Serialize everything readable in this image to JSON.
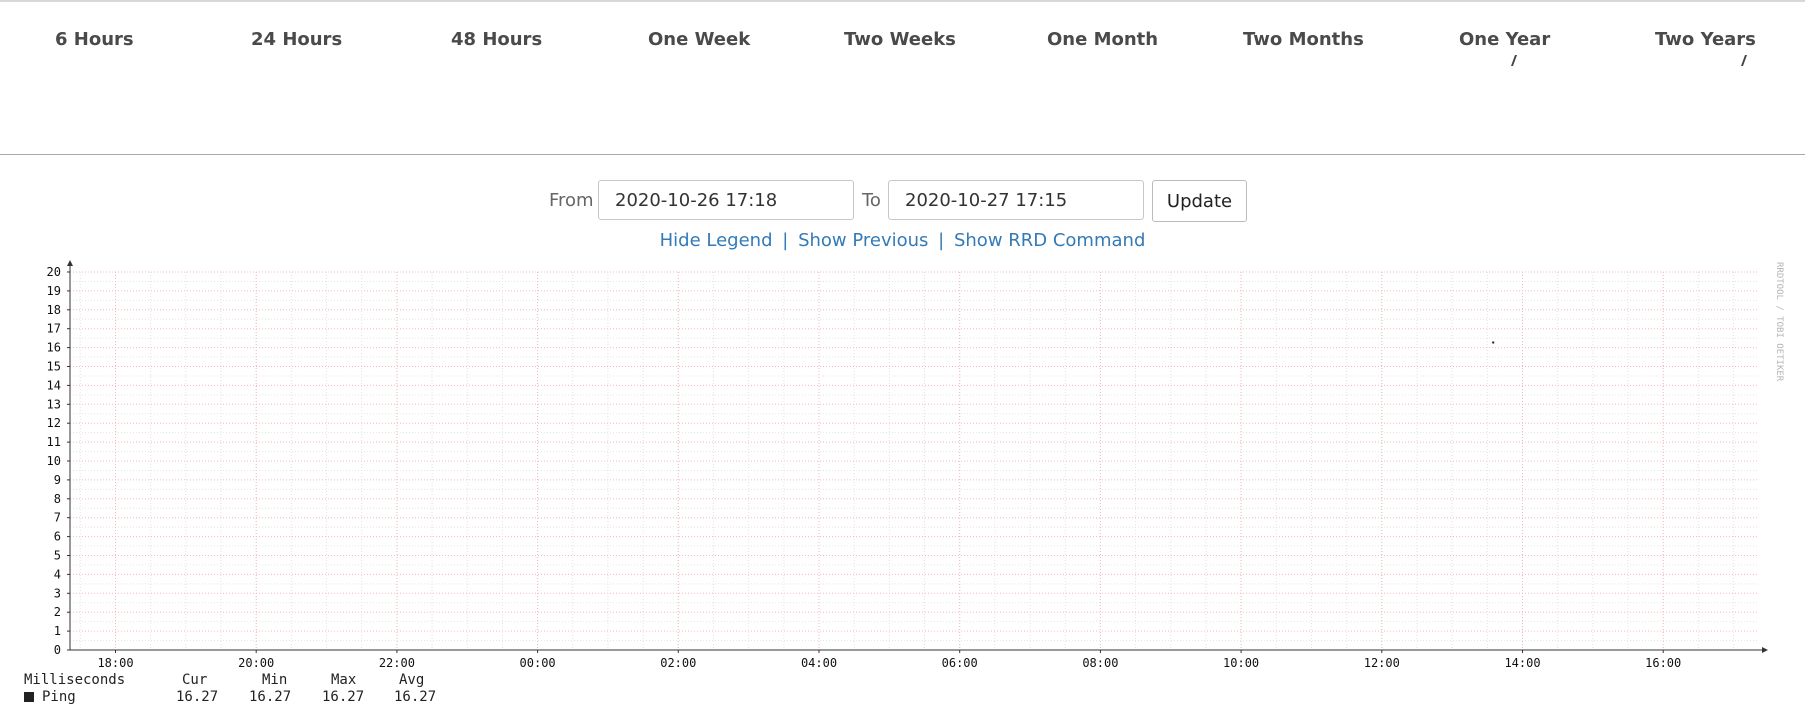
{
  "tabs": [
    "6 Hours",
    "24 Hours",
    "48 Hours",
    "One Week",
    "Two Weeks",
    "One Month",
    "Two Months",
    "One Year",
    "Two Years"
  ],
  "range": {
    "from_label": "From",
    "from_value": "2020-10-26 17:18",
    "to_label": "To",
    "to_value": "2020-10-27 17:15",
    "update_label": "Update"
  },
  "links": {
    "hide_legend": "Hide Legend",
    "separator": "|",
    "show_previous": "Show Previous",
    "show_rrd": "Show RRD Command"
  },
  "chart_data": {
    "type": "line",
    "yticks": [
      "20",
      "19",
      "18",
      "17",
      "16",
      "15",
      "14",
      "13",
      "12",
      "11",
      "10",
      "9",
      "8",
      "7",
      "6",
      "5",
      "4",
      "3",
      "2",
      "1",
      "0"
    ],
    "ylim": [
      0,
      20
    ],
    "xticks": [
      "18:00",
      "20:00",
      "22:00",
      "00:00",
      "02:00",
      "04:00",
      "06:00",
      "08:00",
      "10:00",
      "12:00",
      "14:00",
      "16:00"
    ],
    "grid": true,
    "watermark": "RRDTOOL / TOBI OETIKER",
    "series": [
      {
        "name": "Ping",
        "color": "#222222",
        "points": [
          {
            "x": "13:35",
            "y": 16.27
          }
        ]
      }
    ],
    "legend": {
      "headers": [
        "Milliseconds",
        "Cur",
        "Min",
        "Max",
        "Avg"
      ],
      "rows": [
        {
          "name": "Ping",
          "cur": "16.27",
          "min": "16.27",
          "max": "16.27",
          "avg": "16.27"
        }
      ]
    }
  }
}
